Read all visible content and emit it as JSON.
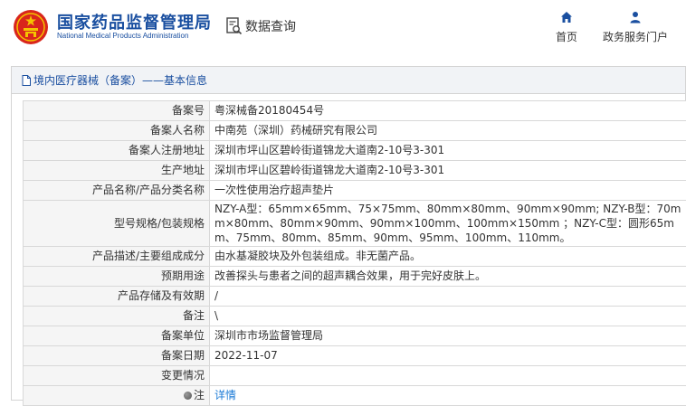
{
  "header": {
    "org_name_cn": "国家药品监督管理局",
    "org_name_en": "National Medical Products Administration",
    "query_label": "数据查询",
    "nav": [
      {
        "label": "首页",
        "icon": "home-icon"
      },
      {
        "label": "政务服务门户",
        "icon": "user-icon"
      }
    ]
  },
  "breadcrumb": "境内医疗器械（备案）——基本信息",
  "colors": {
    "brand_blue": "#1a4fa0",
    "link_blue": "#1a7ad6",
    "label_bg": "#f5f5f5",
    "crumb_bg": "#f1f3f6"
  },
  "rows": [
    {
      "label": "备案号",
      "value": "粤深械备20180454号"
    },
    {
      "label": "备案人名称",
      "value": "中南苑（深圳）药械研究有限公司"
    },
    {
      "label": "备案人注册地址",
      "value": "深圳市坪山区碧岭街道锦龙大道南2-10号3-301"
    },
    {
      "label": "生产地址",
      "value": "深圳市坪山区碧岭街道锦龙大道南2-10号3-301"
    },
    {
      "label": "产品名称/产品分类名称",
      "value": "一次性使用治疗超声垫片"
    },
    {
      "label": "型号规格/包装规格",
      "value": "NZY-A型：65mm×65mm、75×75mm、80mm×80mm、90mm×90mm; NZY-B型：70mm×80mm、80mm×90mm、90mm×100mm、100mm×150mm ；NZY-C型：圆形65mm、75mm、80mm、85mm、90mm、95mm、100mm、110mm。"
    },
    {
      "label": "产品描述/主要组成成分",
      "value": "由水基凝胶块及外包装组成。非无菌产品。"
    },
    {
      "label": "预期用途",
      "value": "改善探头与患者之间的超声耦合效果，用于完好皮肤上。"
    },
    {
      "label": "产品存储及有效期",
      "value": "/"
    },
    {
      "label": "备注",
      "value": "\\"
    },
    {
      "label": "备案单位",
      "value": "深圳市市场监督管理局"
    },
    {
      "label": "备案日期",
      "value": "2022-11-07"
    },
    {
      "label": "变更情况",
      "value": ""
    },
    {
      "label": "注",
      "value": "详情"
    }
  ]
}
